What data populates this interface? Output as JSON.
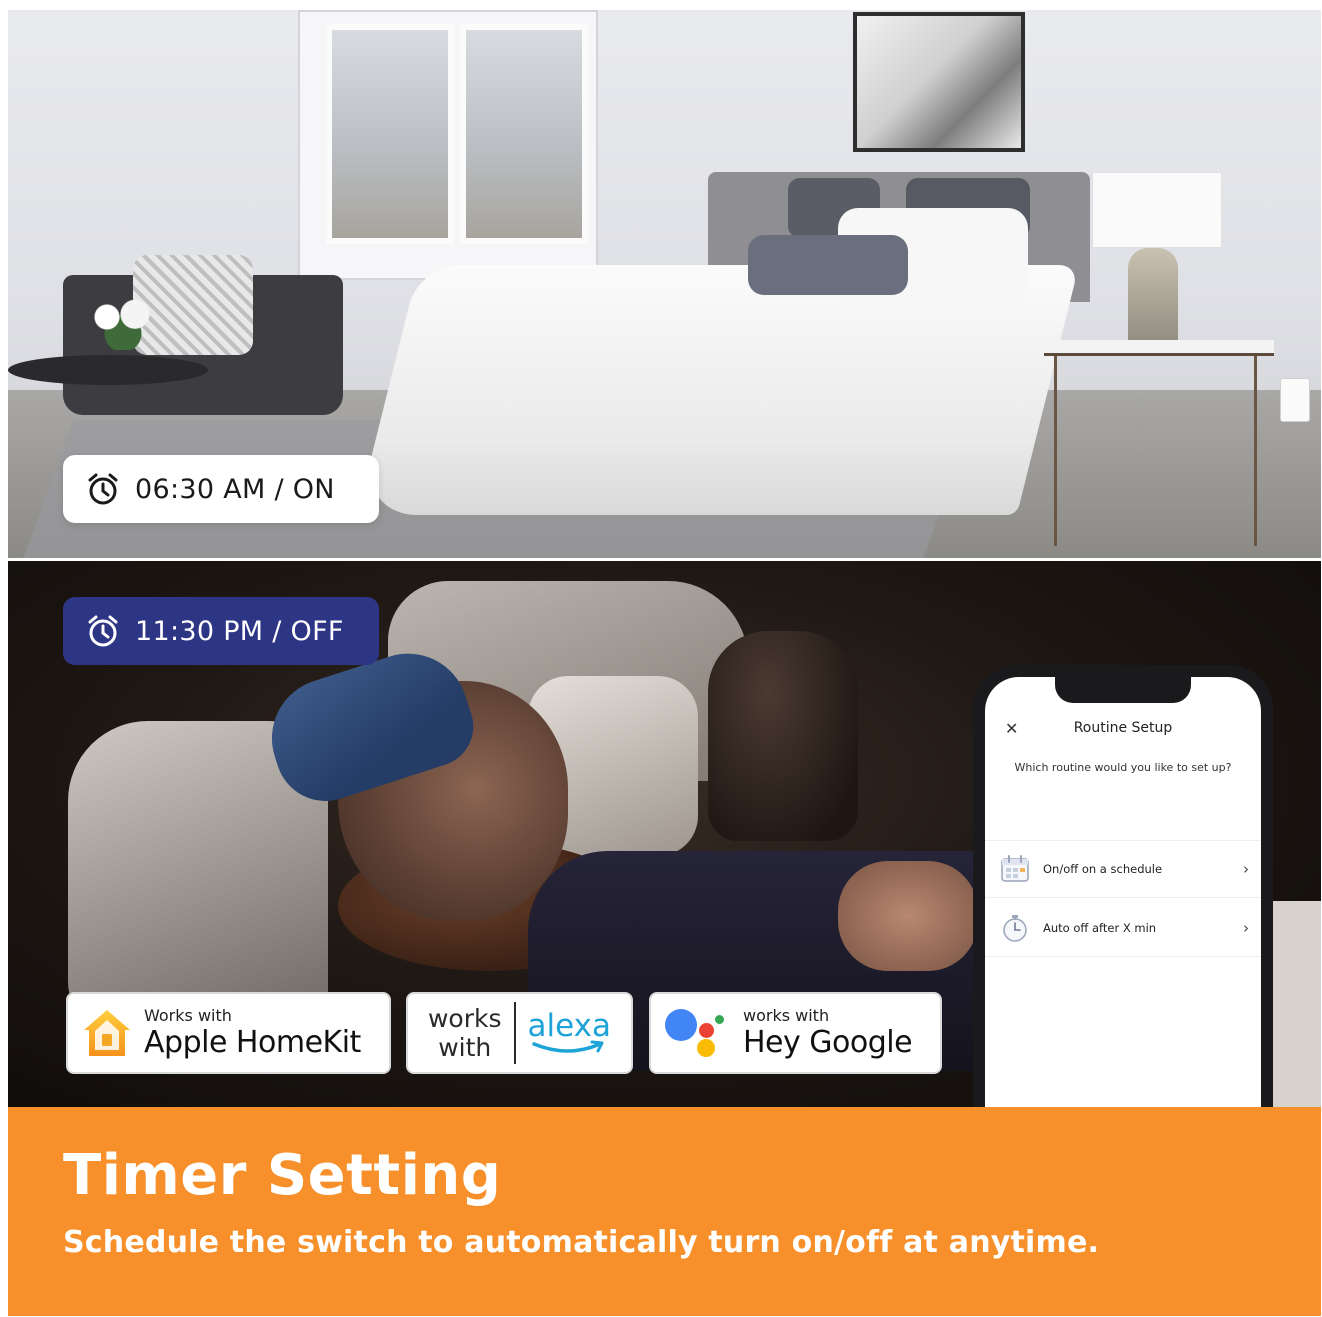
{
  "schedule": {
    "on_badge": {
      "time_label": "06:30 AM / ON",
      "icon": "alarm-clock-icon"
    },
    "off_badge": {
      "time_label": "11:30 PM / OFF",
      "icon": "alarm-clock-icon"
    }
  },
  "compatibility": {
    "homekit": {
      "small": "Works with",
      "big": "Apple HomeKit",
      "icon": "home-icon"
    },
    "alexa": {
      "works": "works",
      "with": "with",
      "brand": "alexa"
    },
    "google": {
      "small": "works with",
      "big": "Hey Google",
      "icon": "google-assistant-icon"
    }
  },
  "phone": {
    "title": "Routine Setup",
    "close_icon": "close-icon",
    "question": "Which routine would you like to set up?",
    "routines": [
      {
        "label": "On/off on a schedule",
        "icon": "calendar-icon"
      },
      {
        "label": "Auto off after X min",
        "icon": "stopwatch-icon"
      }
    ],
    "chevron": "›"
  },
  "footer": {
    "title": "Timer Setting",
    "subtitle": "Schedule the switch to automatically turn on/off at anytime."
  },
  "colors": {
    "accent_orange": "#f7902b",
    "off_badge": "#2d3585",
    "alexa_blue": "#1ea3d8"
  }
}
